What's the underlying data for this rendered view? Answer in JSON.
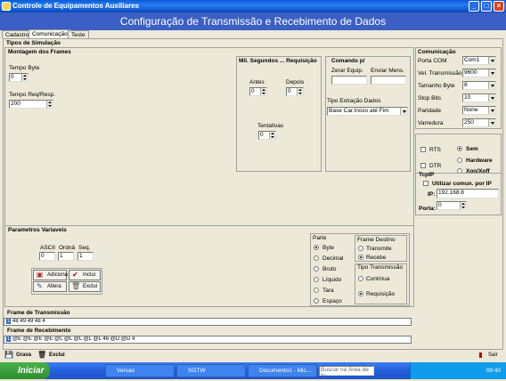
{
  "window": {
    "title": "Controle de Equipamentos Auxiliares",
    "header": "Configuração de Transmissão e Recebimento de Dados"
  },
  "tabs": [
    "Cadastro",
    "Comunicação",
    "Teste"
  ],
  "tipos_simulacao": "Tipos de Simulação",
  "montagem": {
    "title": "Montagem dos Frames",
    "tempo_byte_label": "Tempo Byte",
    "tempo_byte": "0",
    "tempo_req_label": "Tempo Req/Resp.",
    "tempo_req": "200"
  },
  "milisegundos": {
    "title": "Mil. Segundos ... Requisição",
    "antes_label": "Antes",
    "antes": "0",
    "depois_label": "Depois",
    "depois": "0",
    "tentativas_label": "Tentativas",
    "tentativas": "0"
  },
  "comando": {
    "title": "Comando p/",
    "zerar_label": "Zerar Equip.",
    "enviar_label": "Enviar Mens.",
    "tipo_extracao_label": "Tipo Extração Dados",
    "tipo_extracao": "Base Car.Início até Fim"
  },
  "comunicacao": {
    "title": "Comunicação",
    "porta_label": "Porta COM",
    "porta": "Com1",
    "vel_label": "Vel. Transmissão",
    "vel": "9600",
    "tamanho_label": "Tamanho Byte",
    "tamanho": "8",
    "stop_label": "Stop Bits",
    "stop": "10",
    "paridade_label": "Paridade",
    "paridade": "None",
    "varredura_label": "Varredura",
    "varredura": "250"
  },
  "controle": {
    "rts": "RTS",
    "dtr": "DTR",
    "sem": "Sem",
    "hardware": "Hardware",
    "xon": "Xon/Xoff"
  },
  "tcpip": {
    "title": "TcpIP",
    "utilizar": "Utilizar comun. por IP",
    "ip_label": "IP:",
    "ip": "192.168.8",
    "porta_label": "Porta:",
    "porta": "0"
  },
  "parametros": {
    "title": "Parametros Variaveis",
    "ascii_label": "ASCII",
    "ascii": "0",
    "ordem_label": "Ordnâ",
    "ordem": "1",
    "seq_label": "Seq.",
    "seq": "1",
    "adiciona": "Adiciona",
    "inclui": "Inclui",
    "altera": "Altera",
    "exclui": "Exclui"
  },
  "parte": {
    "title": "Parte",
    "options": [
      "Byte",
      "Decimal",
      "Bruto",
      "Líquido",
      "Tara",
      "Espaço"
    ],
    "selected": "Byte"
  },
  "frame_destino": {
    "title": "Frame Destino",
    "transmite": "Transmite",
    "recebe": "Recebe",
    "selected": "Recebe"
  },
  "tipo_transmissao": {
    "title": "Tipo Transmissão",
    "continua": "Contínua",
    "requisicao": "Requisição",
    "selected": "Requisição"
  },
  "frame_transmissao": {
    "title": "Frame de Transmissão",
    "index": "1",
    "data": "48  49  49  48  4"
  },
  "frame_recebimento": {
    "title": "Frame de Recebimento",
    "index": "1",
    "data": "@E @E @E @E @L @L @L @L @L 46  @D @D 4"
  },
  "bottom": {
    "grava": "Grava",
    "exclui": "Exclui",
    "sair": "Sair"
  },
  "taskbar": {
    "start": "Iniciar",
    "items": [
      "Versao",
      "SGTW",
      "Documento1 - Mic..."
    ],
    "search": "Buscar na Área de Tr",
    "clock": "09:40"
  }
}
